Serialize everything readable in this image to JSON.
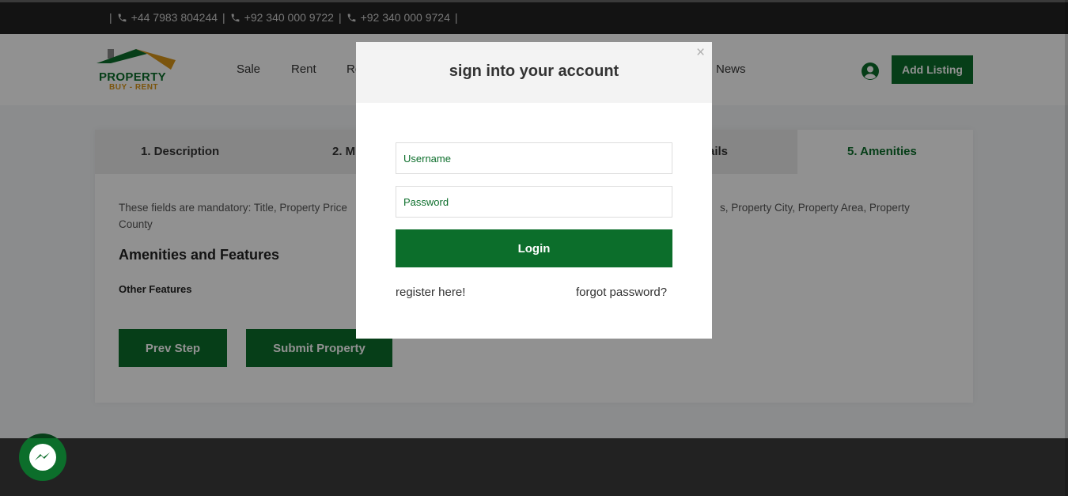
{
  "topbar": {
    "phones": [
      "+44 7983 804244",
      "+92 340 000 9722",
      "+92 340 000 9724"
    ],
    "sep": "|"
  },
  "header": {
    "logo": {
      "word1": "PROPERTY",
      "word2": "BUY - RENT"
    },
    "nav": {
      "sale": "Sale",
      "rent": "Rent",
      "partial": "Re",
      "news": "News"
    },
    "add_listing": "Add Listing"
  },
  "steps": {
    "tab1": "1. Description",
    "tab2_partial": "2. M",
    "tab4_partial": "tails",
    "tab5": "5. Amenities"
  },
  "form": {
    "mandatory_left": "These fields are mandatory: Title, Property Price",
    "mandatory_right": "s, Property City, Property Area, Property",
    "mandatory_second": "County",
    "amenities_title": "Amenities and Features",
    "other_features": "Other Features",
    "prev_step": "Prev Step",
    "submit": "Submit Property"
  },
  "modal": {
    "title": "sign into your account",
    "close": "×",
    "username_placeholder": "Username",
    "password_placeholder": "Password",
    "login": "Login",
    "register": "register here!",
    "forgot": "forgot password?"
  },
  "colors": {
    "brand_green": "#0c6e2b",
    "brand_orange": "#d9961a",
    "dark": "#222222"
  },
  "icons": [
    "phone-icon",
    "user-circle-icon",
    "messenger-icon",
    "close-icon"
  ]
}
